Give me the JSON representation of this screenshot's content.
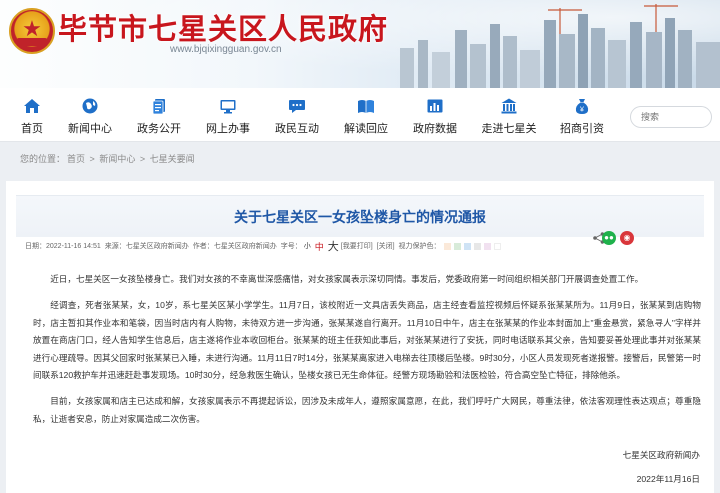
{
  "header": {
    "site_title": "毕节市七星关区人民政府",
    "site_url": "www.bjqixingguan.gov.cn",
    "colors": {
      "title": "#c8161d",
      "nav_icon": "#1f6fc8",
      "link_blue": "#1f57a6"
    }
  },
  "nav": {
    "items": [
      {
        "label": "首页",
        "icon": "home-icon"
      },
      {
        "label": "新闻中心",
        "icon": "globe-icon"
      },
      {
        "label": "政务公开",
        "icon": "document-icon"
      },
      {
        "label": "网上办事",
        "icon": "monitor-icon"
      },
      {
        "label": "政民互动",
        "icon": "chat-icon"
      },
      {
        "label": "解读回应",
        "icon": "book-icon"
      },
      {
        "label": "政府数据",
        "icon": "bar-chart-icon"
      },
      {
        "label": "走进七星关",
        "icon": "building-icon"
      },
      {
        "label": "招商引资",
        "icon": "money-bag-icon"
      }
    ],
    "search_placeholder": "搜索"
  },
  "breadcrumb": {
    "prefix": "您的位置：",
    "items": [
      "首页",
      "新闻中心",
      "七星关要闻"
    ],
    "separator": ">"
  },
  "article": {
    "title": "关于七星关区一女孩坠楼身亡的情况通报",
    "meta": {
      "date": "日期：2022-11-16 14:51",
      "source": "来源：七星关区政府新闻办",
      "author": "作者：七星关区政府新闻办",
      "font_label": "字号：",
      "font_small": "小",
      "font_mid": "中",
      "font_big": "大",
      "print": "[我要打印]",
      "close": "[关闭]",
      "vision_label": "视力保护色：",
      "vision_colors": [
        "#fbe9d9",
        "#d8ebd9",
        "#cfe3f5",
        "#e7e7e7",
        "#f1e1f0",
        "#ffffff"
      ]
    },
    "paragraphs": [
      "近日，七星关区一女孩坠楼身亡。我们对女孩的不幸离世深感痛惜，对女孩家属表示深切同情。事发后，党委政府第一时间组织相关部门开展调查处置工作。",
      "经调查，死者张某某，女，10岁，系七星关区某小学学生。11月7日，该校附近一文具店丢失商品，店主经查看监控视频后怀疑系张某某所为。11月9日，张某某到店购物时，店主暂扣其作业本和笔袋，因当时店内有人购物，未待双方进一步沟通，张某某遂自行离开。11月10日中午，店主在张某某的作业本封面加上\"重金悬赏，紧急寻人\"字样并放置在商店门口，经人告知学生信息后，店主遂将作业本收回柜台。张某某的班主任获知此事后，对张某某进行了安抚，同时电话联系其父亲，告知要妥善处理此事并对张某某进行心理疏导。因其父回家时张某某已入睡，未进行沟通。11月11日7时14分，张某某离家进入电梯去往顶楼后坠楼。9时30分，小区人员发现死者遂报警。接警后，民警第一时间联系120救护车并迅速赶赴事发现场。10时30分，经急救医生确认，坠楼女孩已无生命体征。经警方现场勘验和法医检验，符合高空坠亡特征，排除他杀。",
      "目前，女孩家属和店主已达成和解，女孩家属表示不再提起诉讼，因涉及未成年人，遵照家属意愿，在此，我们呼吁广大网民，尊重法律，依法客观理性表达观点；尊重隐私，让逝者安息，防止对家属造成二次伤害。"
    ],
    "sign_org": "七星关区政府新闻办",
    "sign_date": "2022年11月16日"
  }
}
